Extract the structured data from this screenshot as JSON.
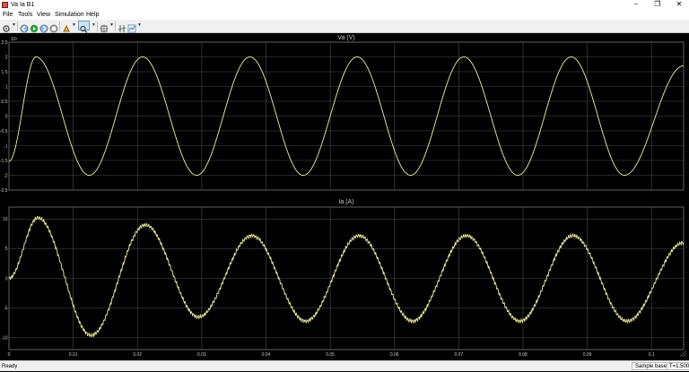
{
  "window": {
    "title": "Va Ia B1",
    "minimize": "–",
    "maximize": "❐",
    "close": "✕"
  },
  "menu": {
    "items": [
      "File",
      "Tools",
      "View",
      "Simulation",
      "Help"
    ]
  },
  "toolbar": {
    "icons": [
      "settings-icon",
      "back-icon",
      "run-icon",
      "step-icon",
      "stop-icon",
      "highlight-icon",
      "zoom-icon",
      "autoscale-icon",
      "cursor-measure-icon",
      "signal-stats-icon"
    ]
  },
  "colors": {
    "plot_background": "#000000",
    "trace": "#f2f0a0",
    "grid": "#4d4d4d",
    "axis_text": "#c8c8c8"
  },
  "status": {
    "text": "Ready",
    "mode": "Sample based",
    "time": "T=1.500"
  },
  "chart_data": [
    {
      "type": "line",
      "title": "Va (V)",
      "exponent_label": "10⁴",
      "xlim": [
        0,
        0.105
      ],
      "ylim": [
        -2.5,
        2.5
      ],
      "yticks": [
        -2.5,
        -2,
        -1.5,
        -1,
        -0.5,
        0,
        0.5,
        1,
        1.5,
        2,
        2.5
      ],
      "ytick_labels": [
        "-2.5",
        "-2",
        "-1.5",
        "-1",
        "-0.5",
        "0",
        "0.5",
        "1",
        "1.5",
        "2",
        "2.5"
      ],
      "grid": true,
      "series": [
        {
          "amplitude": 2,
          "frequency_hz": 60,
          "phase_deg": -50,
          "x": [
            0,
            0.0042,
            0.0125,
            0.0208,
            0.0292,
            0.0375,
            0.0458,
            0.0542,
            0.0625,
            0.0708,
            0.0792,
            0.0875,
            0.0958,
            0.105
          ],
          "y": [
            -1.53,
            2,
            -2,
            2,
            -2,
            2,
            -2,
            2,
            -2,
            2,
            -2,
            2,
            -2,
            1.7
          ]
        }
      ]
    },
    {
      "type": "line",
      "title": "Ia (A)",
      "xlim": [
        0,
        0.105
      ],
      "ylim": [
        -12,
        12
      ],
      "yticks": [
        -10,
        -5,
        0,
        5,
        10
      ],
      "ytick_labels": [
        "-10",
        "-5",
        "0",
        "5",
        "10"
      ],
      "xticks": [
        0,
        0.01,
        0.02,
        0.03,
        0.04,
        0.05,
        0.06,
        0.07,
        0.08,
        0.09,
        0.1
      ],
      "xtick_labels": [
        "0",
        "0.01",
        "0.02",
        "0.03",
        "0.04",
        "0.05",
        "0.06",
        "0.07",
        "0.08",
        "0.09",
        "0.1"
      ],
      "grid": true,
      "series": [
        {
          "frequency_hz": 60,
          "x": [
            0,
            0.0045,
            0.0128,
            0.0212,
            0.0295,
            0.0378,
            0.0462,
            0.0545,
            0.0628,
            0.0712,
            0.0795,
            0.0878,
            0.0962,
            0.105
          ],
          "y": [
            0,
            10.2,
            -9.6,
            9,
            -6.5,
            7.2,
            -7.2,
            7.2,
            -7.2,
            7.2,
            -7.2,
            7.2,
            -7.2,
            6
          ]
        }
      ]
    }
  ]
}
